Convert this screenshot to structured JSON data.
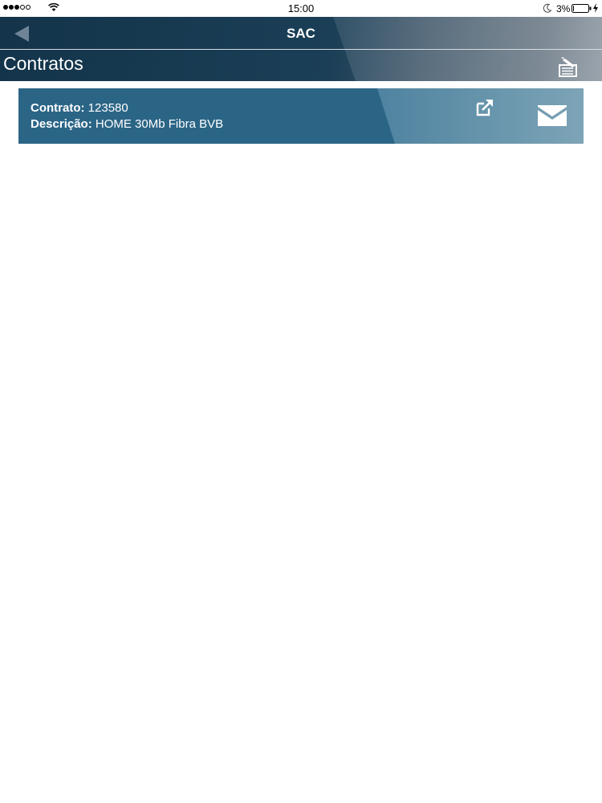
{
  "status_bar": {
    "time": "15:00",
    "battery": "3%",
    "signal_icon": "signal-dots-icon",
    "wifi_icon": "wifi-icon",
    "moon_icon": "moon-icon",
    "battery_icon": "battery-icon",
    "charge_icon": "charging-bolt-icon",
    "battery_level": 0.03
  },
  "nav": {
    "title": "SAC",
    "back_icon": "back-arrow-icon"
  },
  "header": {
    "title": "Contratos",
    "edit_icon": "edit-note-icon"
  },
  "contracts": [
    {
      "contract_label": "Contrato:",
      "contract_value": "123580",
      "description_label": "Descrição:",
      "description_value": "HOME 30Mb Fibra BVB",
      "open_icon": "external-link-icon",
      "mail_icon": "envelope-icon"
    }
  ],
  "colors": {
    "nav_background": "#1b3f57",
    "card_background": "#2b6586",
    "text_on_dark": "#ffffff"
  }
}
